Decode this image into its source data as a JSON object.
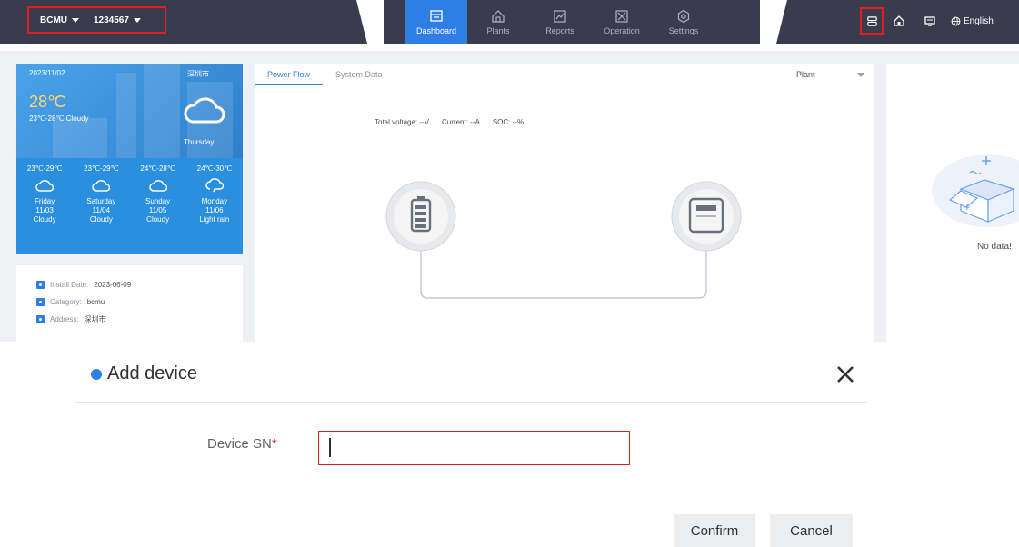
{
  "header": {
    "company": "BCMU",
    "plant_id": "1234567",
    "nav": [
      {
        "label": "Dashboard",
        "icon": "dashboard-icon",
        "active": true
      },
      {
        "label": "Plants",
        "icon": "plants-icon",
        "active": false
      },
      {
        "label": "Reports",
        "icon": "reports-icon",
        "active": false
      },
      {
        "label": "Operation",
        "icon": "operation-icon",
        "active": false
      },
      {
        "label": "Settings",
        "icon": "settings-icon",
        "active": false
      }
    ],
    "language": "English"
  },
  "weather": {
    "date": "2023/11/02",
    "city": "深圳市",
    "temperature": "28℃",
    "description": "23℃-28℃ Cloudy",
    "weekday": "Thursday",
    "forecast": [
      {
        "range": "23℃-29℃",
        "day": "Friday",
        "date": "11/03",
        "condition": "Cloudy",
        "icon": "cloudy-icon"
      },
      {
        "range": "23℃-29℃",
        "day": "Saturday",
        "date": "11/04",
        "condition": "Cloudy",
        "icon": "cloudy-icon"
      },
      {
        "range": "24℃-28℃",
        "day": "Sunday",
        "date": "11/05",
        "condition": "Cloudy",
        "icon": "cloudy-icon"
      },
      {
        "range": "24℃-30℃",
        "day": "Monday",
        "date": "11/06",
        "condition": "Light rain",
        "icon": "light-rain-icon"
      }
    ]
  },
  "plant_info": {
    "install_label": "Install Date:",
    "install_value": "2023-06-09",
    "category_label": "Category:",
    "category_value": "bcmu",
    "address_label": "Address:",
    "address_value": "深圳市"
  },
  "center": {
    "tabs": [
      "Power Flow",
      "System Data"
    ],
    "plant_select": "Plant",
    "stats": {
      "voltage": "Total voltage: --V",
      "current": "Current: --A",
      "soc": "SOC: --%"
    }
  },
  "right_panel": {
    "empty_text": "No data!"
  },
  "dialog": {
    "title": "Add device",
    "field_label": "Device SN",
    "required_mark": "*",
    "input_value": "",
    "input_placeholder": "",
    "confirm_label": "Confirm",
    "cancel_label": "Cancel"
  },
  "colors": {
    "accent": "#2f7ee6",
    "topbar": "#3a3c4d",
    "highlight_border": "#e02020"
  }
}
